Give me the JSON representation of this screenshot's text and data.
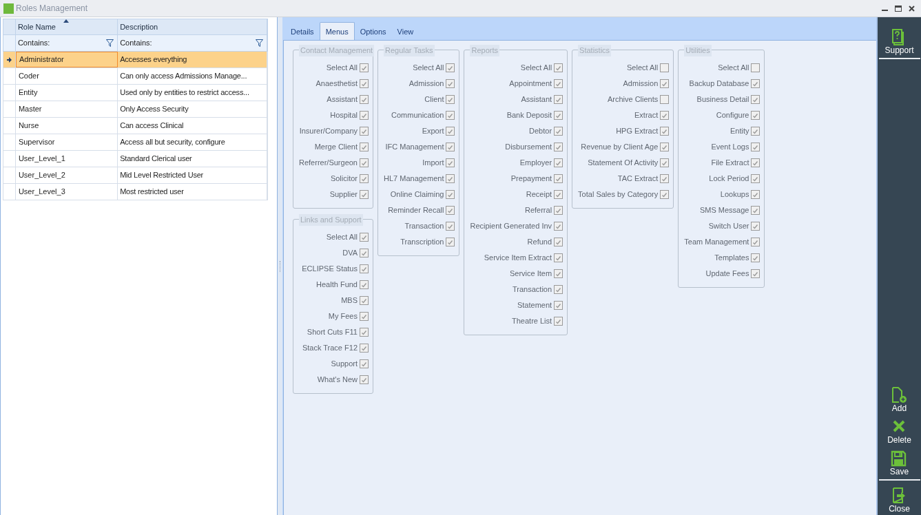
{
  "window": {
    "title": "Roles Management"
  },
  "grid": {
    "columns": [
      {
        "label": "Role Name",
        "sorted": true,
        "filter": "Contains:"
      },
      {
        "label": "Description",
        "sorted": false,
        "filter": "Contains:"
      }
    ],
    "rows": [
      {
        "name": "Administrator",
        "description": "Accesses everything",
        "selected": true
      },
      {
        "name": "Coder",
        "description": "Can only access Admissions Manage...",
        "selected": false
      },
      {
        "name": "Entity",
        "description": "Used only by entities to restrict access...",
        "selected": false
      },
      {
        "name": "Master",
        "description": "Only Access Security",
        "selected": false
      },
      {
        "name": "Nurse",
        "description": "Can access Clinical",
        "selected": false
      },
      {
        "name": "Supervisor",
        "description": "Access all but security, configure",
        "selected": false
      },
      {
        "name": "User_Level_1",
        "description": "Standard Clerical user",
        "selected": false
      },
      {
        "name": "User_Level_2",
        "description": "Mid Level Restricted User",
        "selected": false
      },
      {
        "name": "User_Level_3",
        "description": "Most restricted user",
        "selected": false
      }
    ]
  },
  "tabs": [
    {
      "label": "Details",
      "selected": false
    },
    {
      "label": "Menus",
      "selected": true
    },
    {
      "label": "Options",
      "selected": false
    },
    {
      "label": "View",
      "selected": false
    }
  ],
  "menu_columns": [
    {
      "groups": [
        {
          "title": "Contact Management",
          "items": [
            {
              "label": "Select All",
              "checked": true
            },
            {
              "label": "Anaesthetist",
              "checked": true
            },
            {
              "label": "Assistant",
              "checked": true
            },
            {
              "label": "Hospital",
              "checked": true
            },
            {
              "label": "Insurer/Company",
              "checked": true
            },
            {
              "label": "Merge Client",
              "checked": true
            },
            {
              "label": "Referrer/Surgeon",
              "checked": true
            },
            {
              "label": "Solicitor",
              "checked": true
            },
            {
              "label": "Supplier",
              "checked": true
            }
          ]
        },
        {
          "title": "Links and Support",
          "items": [
            {
              "label": "Select All",
              "checked": true
            },
            {
              "label": "DVA",
              "checked": true
            },
            {
              "label": "ECLIPSE Status",
              "checked": true
            },
            {
              "label": "Health Fund",
              "checked": true
            },
            {
              "label": "MBS",
              "checked": true
            },
            {
              "label": "My Fees",
              "checked": true
            },
            {
              "label": "Short Cuts F11",
              "checked": true
            },
            {
              "label": "Stack Trace F12",
              "checked": true
            },
            {
              "label": "Support",
              "checked": true
            },
            {
              "label": "What's New",
              "checked": true
            }
          ]
        }
      ]
    },
    {
      "groups": [
        {
          "title": "Regular Tasks",
          "items": [
            {
              "label": "Select All",
              "checked": true
            },
            {
              "label": "Admission",
              "checked": true
            },
            {
              "label": "Client",
              "checked": true
            },
            {
              "label": "Communication",
              "checked": true
            },
            {
              "label": "Export",
              "checked": true
            },
            {
              "label": "IFC Management",
              "checked": true
            },
            {
              "label": "Import",
              "checked": true
            },
            {
              "label": "HL7 Management",
              "checked": true
            },
            {
              "label": "Online Claiming",
              "checked": true
            },
            {
              "label": "Reminder Recall",
              "checked": true
            },
            {
              "label": "Transaction",
              "checked": true
            },
            {
              "label": "Transcription",
              "checked": true
            }
          ]
        }
      ]
    },
    {
      "groups": [
        {
          "title": "Reports",
          "items": [
            {
              "label": "Select All",
              "checked": true
            },
            {
              "label": "Appointment",
              "checked": true
            },
            {
              "label": "Assistant",
              "checked": true
            },
            {
              "label": "Bank Deposit",
              "checked": true
            },
            {
              "label": "Debtor",
              "checked": true
            },
            {
              "label": "Disbursement",
              "checked": true
            },
            {
              "label": "Employer",
              "checked": true
            },
            {
              "label": "Prepayment",
              "checked": true
            },
            {
              "label": "Receipt",
              "checked": true
            },
            {
              "label": "Referral",
              "checked": true
            },
            {
              "label": "Recipient Generated Inv",
              "checked": true
            },
            {
              "label": "Refund",
              "checked": true
            },
            {
              "label": "Service Item Extract",
              "checked": true
            },
            {
              "label": "Service Item",
              "checked": true
            },
            {
              "label": "Transaction",
              "checked": true
            },
            {
              "label": "Statement",
              "checked": true
            },
            {
              "label": "Theatre List",
              "checked": true
            }
          ]
        }
      ]
    },
    {
      "groups": [
        {
          "title": "Statistics",
          "items": [
            {
              "label": "Select All",
              "checked": false
            },
            {
              "label": "Admission",
              "checked": true
            },
            {
              "label": "Archive Clients",
              "checked": false
            },
            {
              "label": "Extract",
              "checked": true
            },
            {
              "label": "HPG Extract",
              "checked": true
            },
            {
              "label": "Revenue by Client Age",
              "checked": true
            },
            {
              "label": "Statement Of Activity",
              "checked": true
            },
            {
              "label": "TAC Extract",
              "checked": true
            },
            {
              "label": "Total Sales by Category",
              "checked": true
            }
          ]
        }
      ]
    },
    {
      "groups": [
        {
          "title": "Utilities",
          "items": [
            {
              "label": "Select All",
              "checked": false
            },
            {
              "label": "Backup Database",
              "checked": true
            },
            {
              "label": "Business Detail",
              "checked": true
            },
            {
              "label": "Configure",
              "checked": true
            },
            {
              "label": "Entity",
              "checked": true
            },
            {
              "label": "Event Logs",
              "checked": true
            },
            {
              "label": "File Extract",
              "checked": true
            },
            {
              "label": "Lock Period",
              "checked": true
            },
            {
              "label": "Lookups",
              "checked": true
            },
            {
              "label": "SMS Message",
              "checked": true
            },
            {
              "label": "Switch User",
              "checked": true
            },
            {
              "label": "Team Management",
              "checked": true
            },
            {
              "label": "Templates",
              "checked": true
            },
            {
              "label": "Update Fees",
              "checked": true
            }
          ]
        }
      ]
    }
  ],
  "sidebar": {
    "top": [
      {
        "kind": "support",
        "label": "Support"
      }
    ],
    "bottom": [
      {
        "kind": "add",
        "label": "Add"
      },
      {
        "kind": "delete",
        "label": "Delete"
      },
      {
        "kind": "save",
        "label": "Save"
      },
      {
        "kind": "close",
        "label": "Close"
      }
    ]
  }
}
